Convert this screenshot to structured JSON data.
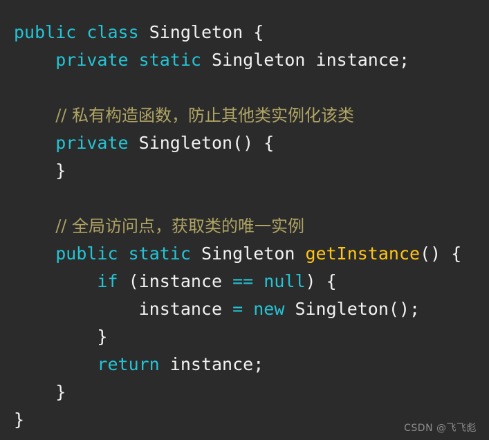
{
  "editor": {
    "background_color": "#2b2b2b",
    "language": "java",
    "colors": {
      "keyword": "#24c4d6",
      "comment": "#b0a464",
      "method": "#ffc514",
      "text": "#f2f2f2"
    },
    "lines": [
      {
        "index": 1,
        "indent": 0,
        "text": "public class Singleton {",
        "tokens": [
          {
            "t": "public",
            "k": "keyword"
          },
          {
            "t": " ",
            "k": "plain"
          },
          {
            "t": "class",
            "k": "keyword"
          },
          {
            "t": " ",
            "k": "plain"
          },
          {
            "t": "Singleton",
            "k": "type"
          },
          {
            "t": " ",
            "k": "plain"
          },
          {
            "t": "{",
            "k": "punct"
          }
        ]
      },
      {
        "index": 2,
        "indent": 1,
        "text": "    private static Singleton instance;",
        "tokens": [
          {
            "t": "    ",
            "k": "plain"
          },
          {
            "t": "private",
            "k": "keyword"
          },
          {
            "t": " ",
            "k": "plain"
          },
          {
            "t": "static",
            "k": "keyword"
          },
          {
            "t": " ",
            "k": "plain"
          },
          {
            "t": "Singleton",
            "k": "type"
          },
          {
            "t": " ",
            "k": "plain"
          },
          {
            "t": "instance",
            "k": "ident"
          },
          {
            "t": ";",
            "k": "punct"
          }
        ]
      },
      {
        "index": 3,
        "indent": 0,
        "text": "",
        "tokens": []
      },
      {
        "index": 4,
        "indent": 1,
        "text": "    // 私有构造函数，防止其他类实例化该类",
        "tokens": [
          {
            "t": "    ",
            "k": "plain"
          },
          {
            "t": "// 私有构造函数，防止其他类实例化该类",
            "k": "comment"
          }
        ]
      },
      {
        "index": 5,
        "indent": 1,
        "text": "    private Singleton() {",
        "tokens": [
          {
            "t": "    ",
            "k": "plain"
          },
          {
            "t": "private",
            "k": "keyword"
          },
          {
            "t": " ",
            "k": "plain"
          },
          {
            "t": "Singleton",
            "k": "type"
          },
          {
            "t": "() {",
            "k": "punct"
          }
        ]
      },
      {
        "index": 6,
        "indent": 1,
        "text": "    }",
        "tokens": [
          {
            "t": "    ",
            "k": "plain"
          },
          {
            "t": "}",
            "k": "punct"
          }
        ]
      },
      {
        "index": 7,
        "indent": 0,
        "text": "",
        "tokens": []
      },
      {
        "index": 8,
        "indent": 1,
        "text": "    // 全局访问点，获取类的唯一实例",
        "tokens": [
          {
            "t": "    ",
            "k": "plain"
          },
          {
            "t": "// 全局访问点，获取类的唯一实例",
            "k": "comment"
          }
        ]
      },
      {
        "index": 9,
        "indent": 1,
        "text": "    public static Singleton getInstance() {",
        "tokens": [
          {
            "t": "    ",
            "k": "plain"
          },
          {
            "t": "public",
            "k": "keyword"
          },
          {
            "t": " ",
            "k": "plain"
          },
          {
            "t": "static",
            "k": "keyword"
          },
          {
            "t": " ",
            "k": "plain"
          },
          {
            "t": "Singleton",
            "k": "type"
          },
          {
            "t": " ",
            "k": "plain"
          },
          {
            "t": "getInstance",
            "k": "method"
          },
          {
            "t": "() {",
            "k": "punct"
          }
        ]
      },
      {
        "index": 10,
        "indent": 2,
        "text": "        if (instance == null) {",
        "tokens": [
          {
            "t": "        ",
            "k": "plain"
          },
          {
            "t": "if",
            "k": "keyword"
          },
          {
            "t": " (",
            "k": "punct"
          },
          {
            "t": "instance",
            "k": "ident"
          },
          {
            "t": " ",
            "k": "plain"
          },
          {
            "t": "==",
            "k": "keyword"
          },
          {
            "t": " ",
            "k": "plain"
          },
          {
            "t": "null",
            "k": "keyword"
          },
          {
            "t": ") {",
            "k": "punct"
          }
        ]
      },
      {
        "index": 11,
        "indent": 3,
        "text": "            instance = new Singleton();",
        "tokens": [
          {
            "t": "            ",
            "k": "plain"
          },
          {
            "t": "instance",
            "k": "ident"
          },
          {
            "t": " ",
            "k": "plain"
          },
          {
            "t": "=",
            "k": "keyword"
          },
          {
            "t": " ",
            "k": "plain"
          },
          {
            "t": "new",
            "k": "keyword"
          },
          {
            "t": " ",
            "k": "plain"
          },
          {
            "t": "Singleton",
            "k": "type"
          },
          {
            "t": "();",
            "k": "punct"
          }
        ]
      },
      {
        "index": 12,
        "indent": 2,
        "text": "        }",
        "tokens": [
          {
            "t": "        ",
            "k": "plain"
          },
          {
            "t": "}",
            "k": "punct"
          }
        ]
      },
      {
        "index": 13,
        "indent": 2,
        "text": "        return instance;",
        "tokens": [
          {
            "t": "        ",
            "k": "plain"
          },
          {
            "t": "return",
            "k": "keyword"
          },
          {
            "t": " ",
            "k": "plain"
          },
          {
            "t": "instance",
            "k": "ident"
          },
          {
            "t": ";",
            "k": "punct"
          }
        ]
      },
      {
        "index": 14,
        "indent": 1,
        "text": "    }",
        "tokens": [
          {
            "t": "    ",
            "k": "plain"
          },
          {
            "t": "}",
            "k": "punct"
          }
        ]
      },
      {
        "index": 15,
        "indent": 0,
        "text": "}",
        "tokens": [
          {
            "t": "}",
            "k": "punct"
          }
        ]
      }
    ]
  },
  "watermark": {
    "text": "CSDN @飞飞彪"
  }
}
